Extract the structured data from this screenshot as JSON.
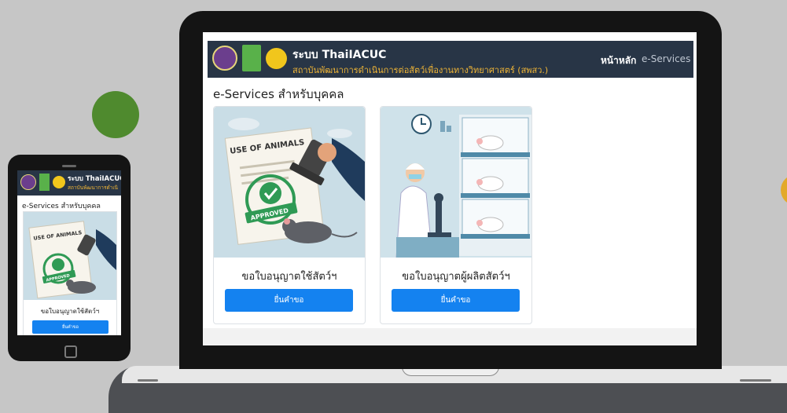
{
  "app": {
    "brand_title": "ระบบ ThaiIACUC",
    "brand_subtitle": "สถาบันพัฒนาการดำเนินการต่อสัตว์เพื่องานทางวิทยาศาสตร์ (สพสว.)"
  },
  "nav": {
    "home": "หน้าหลัก",
    "eservices": "e-Services"
  },
  "page": {
    "heading": "e-Services สำหรับบุคคล"
  },
  "cards": [
    {
      "image_text": "USE OF ANIMALS",
      "stamp_text": "APPROVED",
      "title": "ขอใบอนุญาตใช้สัตว์ฯ",
      "button": "ยื่นคำขอ"
    },
    {
      "title": "ขอใบอนุญาตผู้ผลิตสัตว์ฯ",
      "button": "ยื่นคำขอ"
    }
  ],
  "mobile": {
    "brand_title": "ระบบ ThaiIACUC",
    "brand_subtitle": "สถาบันพัฒนาการดำเนิ",
    "heading": "e-Services สำหรับบุคคล",
    "card": {
      "image_text": "USE OF ANIMALS",
      "stamp_text": "APPROVED",
      "title": "ขอใบอนุญาตใช้สัตว์ฯ",
      "button": "ยื่นคำขอ"
    }
  },
  "colors": {
    "topbar": "#283546",
    "accent": "#1482f0",
    "subtitle": "#f0b536"
  }
}
